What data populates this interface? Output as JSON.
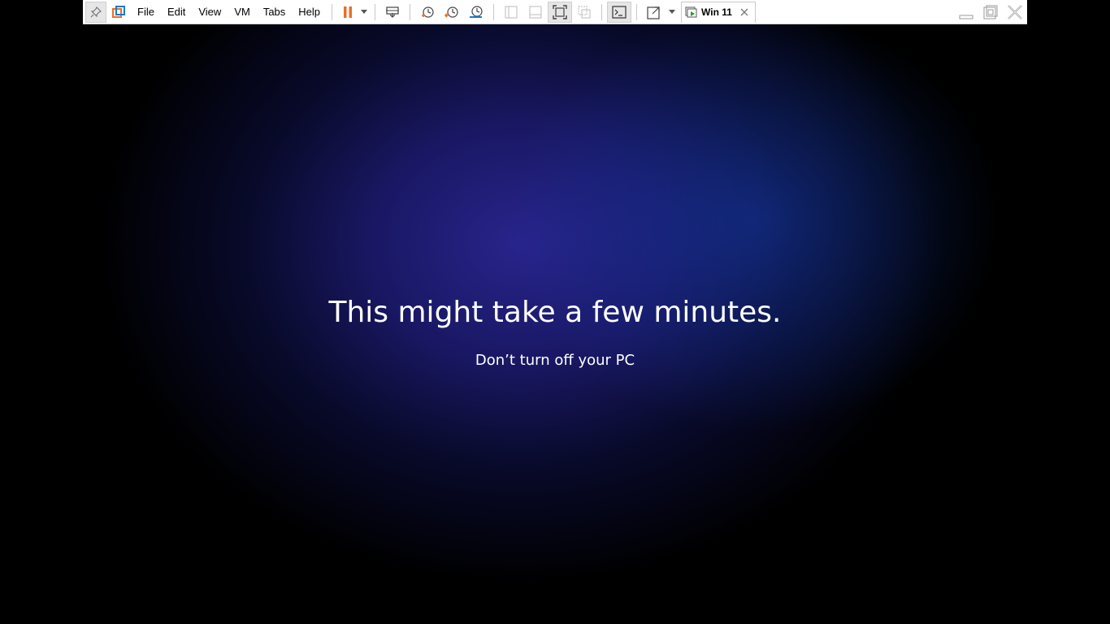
{
  "toolbar": {
    "menu": {
      "file": "File",
      "edit": "Edit",
      "view": "View",
      "vm": "VM",
      "tabs": "Tabs",
      "help": "Help"
    },
    "tab": {
      "label": "Win 11"
    },
    "colors": {
      "pause_accent": "#e8702a",
      "snapshot_accent": "#e8702a",
      "snapshot_blue": "#1a7ac8"
    }
  },
  "screen": {
    "title": "This might take a few minutes.",
    "subtitle": "Don’t turn off your PC",
    "colors": {
      "glow": "#28248c",
      "background": "#000000",
      "text": "#ffffff"
    }
  }
}
